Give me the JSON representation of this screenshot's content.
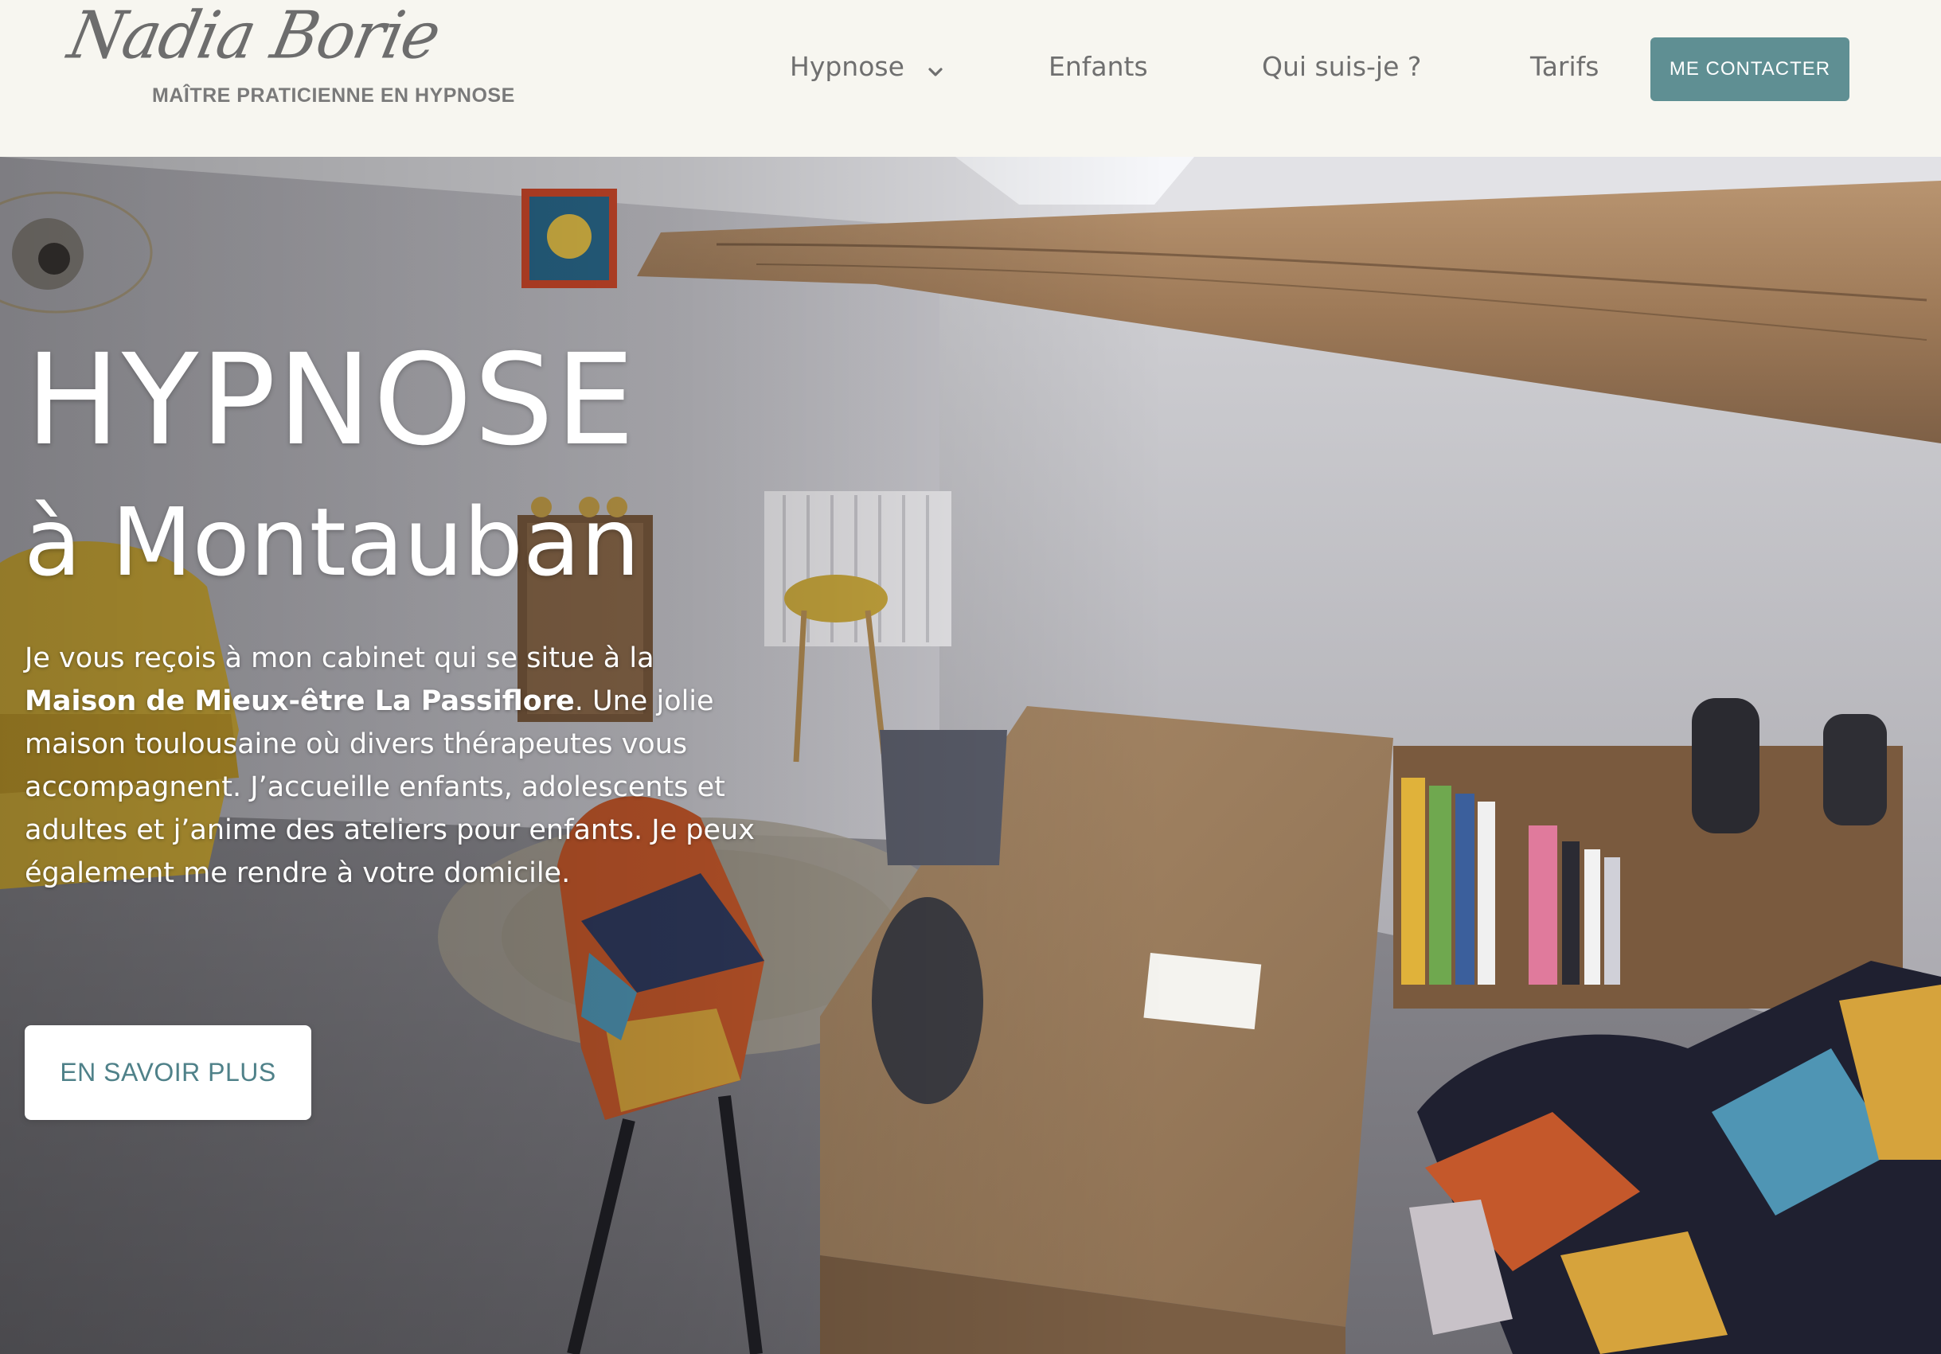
{
  "brand": {
    "logo_text": "Nadia Borie",
    "tagline": "MAÎTRE PRATICIENNE EN HYPNOSE"
  },
  "nav": {
    "items": [
      {
        "label": "Hypnose",
        "has_dropdown": true
      },
      {
        "label": "Enfants"
      },
      {
        "label": "Qui suis-je ?"
      },
      {
        "label": "Tarifs"
      }
    ],
    "cta_label": "ME CONTACTER"
  },
  "hero": {
    "title": "HYPNOSE",
    "subtitle": "à Montauban",
    "paragraph": {
      "part1": "Je vous reçois à mon cabinet qui se situe à la ",
      "bold": "Maison de Mieux-être La Passiflore",
      "part2": ". Une jolie maison toulousaine où divers thérapeutes vous accompagnent. J’accueille enfants, adolescents et adultes et j’anime des ateliers pour enfants. Je peux également me rendre à votre domicile."
    },
    "button_label": "EN SAVOIR PLUS"
  },
  "colors": {
    "header_bg": "#f7f6f0",
    "accent": "#5f8f93",
    "nav_text": "#6f6f6f",
    "button_text": "#4f8189"
  }
}
